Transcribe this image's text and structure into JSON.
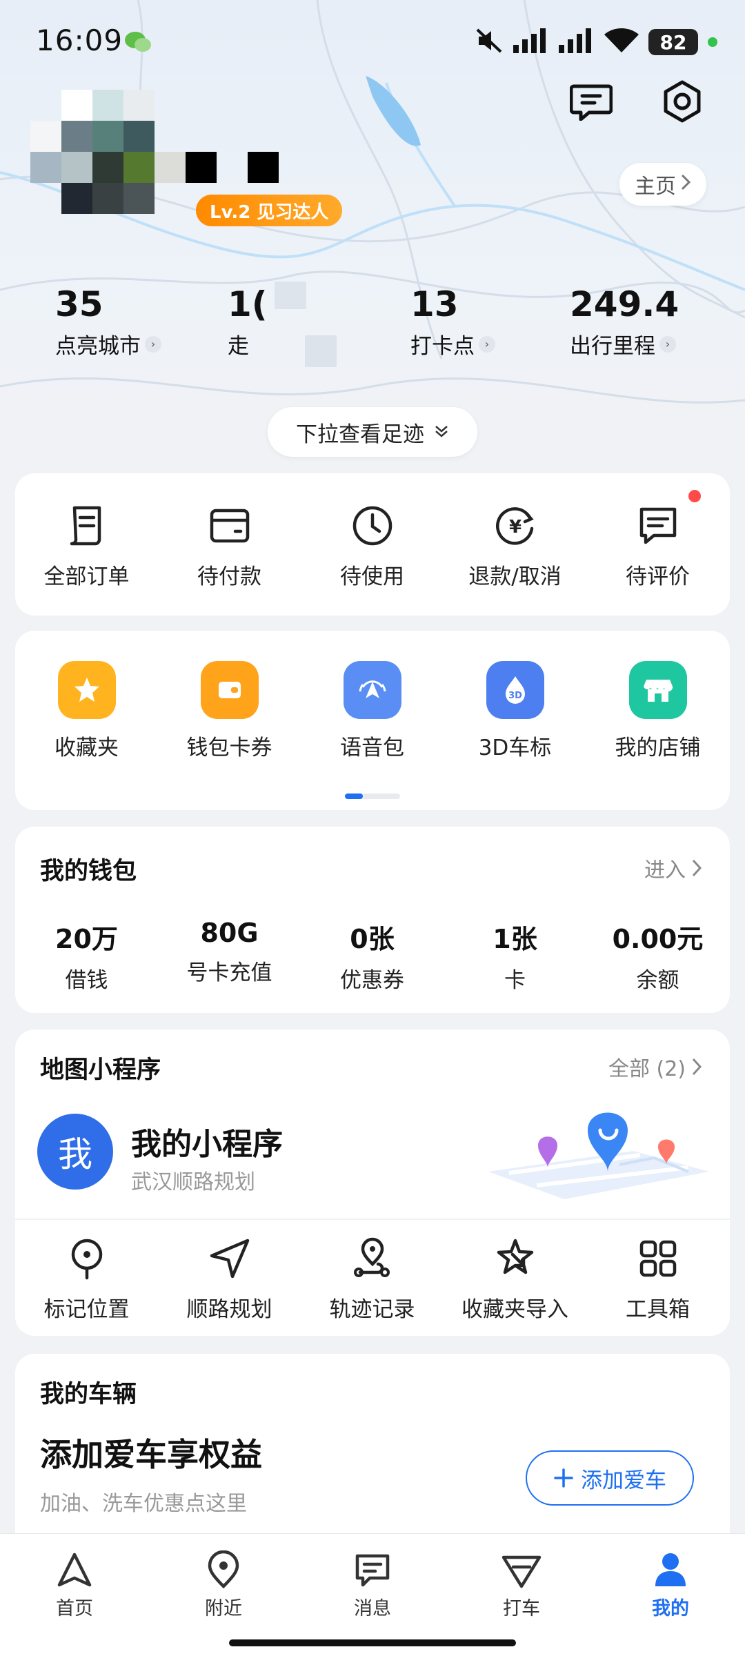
{
  "status_bar": {
    "time": "16:09",
    "battery": "82"
  },
  "profile": {
    "level_badge": "Lv.2 见习达人",
    "home_button": "主页"
  },
  "stats": [
    {
      "value": "35",
      "label": "点亮城市"
    },
    {
      "value": "1(",
      "label": "走"
    },
    {
      "value": "13",
      "label": "打卡点"
    },
    {
      "value": "249.4",
      "label": "出行里程"
    }
  ],
  "pull_down": "下拉查看足迹",
  "orders": [
    {
      "label": "全部订单",
      "icon": "order-list-icon"
    },
    {
      "label": "待付款",
      "icon": "wallet-icon"
    },
    {
      "label": "待使用",
      "icon": "clock-icon"
    },
    {
      "label": "退款/取消",
      "icon": "refund-icon"
    },
    {
      "label": "待评价",
      "icon": "review-icon",
      "has_dot": true
    }
  ],
  "tools": [
    {
      "label": "收藏夹",
      "icon": "star-icon",
      "color": "#ffb41f"
    },
    {
      "label": "钱包卡券",
      "icon": "wallet-card-icon",
      "color": "#ffa31a"
    },
    {
      "label": "语音包",
      "icon": "voice-icon",
      "color": "#5a8ef5"
    },
    {
      "label": "3D车标",
      "icon": "3d-car-icon",
      "color": "#4e7ff0"
    },
    {
      "label": "我的店铺",
      "icon": "shop-icon",
      "color": "#1fc7a0"
    }
  ],
  "wallet": {
    "title": "我的钱包",
    "link": "进入",
    "items": [
      {
        "value": "20万",
        "label": "借钱"
      },
      {
        "value": "80G",
        "label": "号卡充值"
      },
      {
        "value": "0张",
        "label": "优惠券"
      },
      {
        "value": "1张",
        "label": "卡"
      },
      {
        "value": "0.00元",
        "label": "余额"
      }
    ]
  },
  "mini_programs": {
    "title": "地图小程序",
    "link": "全部 (2)",
    "mine": {
      "avatar_char": "我",
      "title": "我的小程序",
      "subtitle": "武汉顺路规划"
    },
    "items": [
      {
        "label": "标记位置",
        "icon": "pin-mark-icon"
      },
      {
        "label": "顺路规划",
        "icon": "navigate-arrow-icon"
      },
      {
        "label": "轨迹记录",
        "icon": "track-icon"
      },
      {
        "label": "收藏夹导入",
        "icon": "star-import-icon"
      },
      {
        "label": "工具箱",
        "icon": "grid-icon"
      }
    ]
  },
  "vehicle": {
    "title": "我的车辆",
    "headline": "添加爱车享权益",
    "subtitle": "加油、洗车优惠点这里",
    "add_button": "添加爱车"
  },
  "bottom_nav": [
    {
      "label": "首页",
      "icon": "home-arrow-icon"
    },
    {
      "label": "附近",
      "icon": "location-icon"
    },
    {
      "label": "消息",
      "icon": "message-icon"
    },
    {
      "label": "打车",
      "icon": "taxi-icon"
    },
    {
      "label": "我的",
      "icon": "user-icon",
      "active": true
    }
  ],
  "colors": {
    "accent": "#1e6ff1",
    "badge": "#ff8a00",
    "dot": "#ff4a4a"
  }
}
